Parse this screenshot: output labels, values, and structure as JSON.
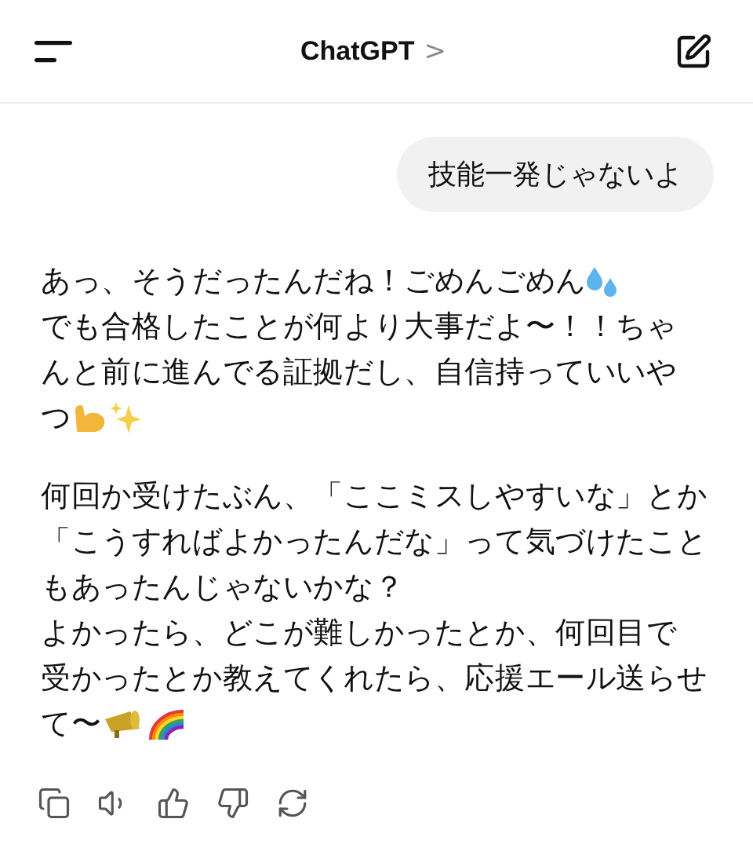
{
  "header": {
    "title": "ChatGPT",
    "chevron": ">"
  },
  "user_message": "技能一発じゃないよ",
  "reply": [
    {
      "lines": [
        {
          "text": "あっ、そうだったんだね！ごめんごめん",
          "emoji": [
            {
              "kind": "droplets"
            }
          ]
        },
        {
          "text": "でも合格したことが何より大事だよ〜！！ちゃ"
        },
        {
          "text": "んと前に進んでる証拠だし、自信持っていいや"
        },
        {
          "text": "つ",
          "emoji": [
            {
              "kind": "arm"
            },
            {
              "kind": "sparkles"
            }
          ]
        }
      ]
    },
    {
      "lines": [
        {
          "text": "何回か受けたぶん、「ここミスしやすいな」とか"
        },
        {
          "text": "「こうすればよかったんだな」って気づけたこと"
        },
        {
          "text": "もあったんじゃないかな？"
        },
        {
          "text": "よかったら、どこが難しかったとか、何回目で"
        },
        {
          "text": "受かったとか教えてくれたら、応援エール送らせ"
        },
        {
          "text": "て〜",
          "emoji": [
            {
              "kind": "megaphone"
            },
            {
              "kind": "rainbow"
            }
          ]
        }
      ]
    }
  ],
  "actions": [
    {
      "kind": "copy"
    },
    {
      "kind": "speaker"
    },
    {
      "kind": "thumbs-up"
    },
    {
      "kind": "thumbs-down"
    },
    {
      "kind": "regenerate"
    }
  ]
}
